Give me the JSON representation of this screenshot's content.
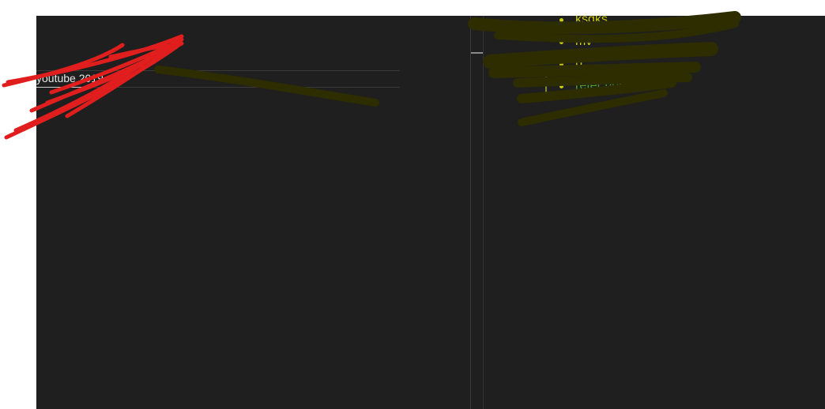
{
  "editor": {
    "input_value": "youtube 2019"
  },
  "notes": {
    "items": [
      {
        "label": "ksgks",
        "color": "#cccc00"
      },
      {
        "label": "mv",
        "color": "#cccc00"
      },
      {
        "label": "b",
        "color": "#cccc00"
      },
      {
        "label": "refer here",
        "color": "#4ea52a"
      }
    ]
  },
  "colors": {
    "background": "#1f1f1f",
    "highlight": "#2d2d00",
    "scribble": "#e01e1e",
    "bullet_yellow": "#cccc00",
    "bullet_green": "#4ea52a"
  }
}
